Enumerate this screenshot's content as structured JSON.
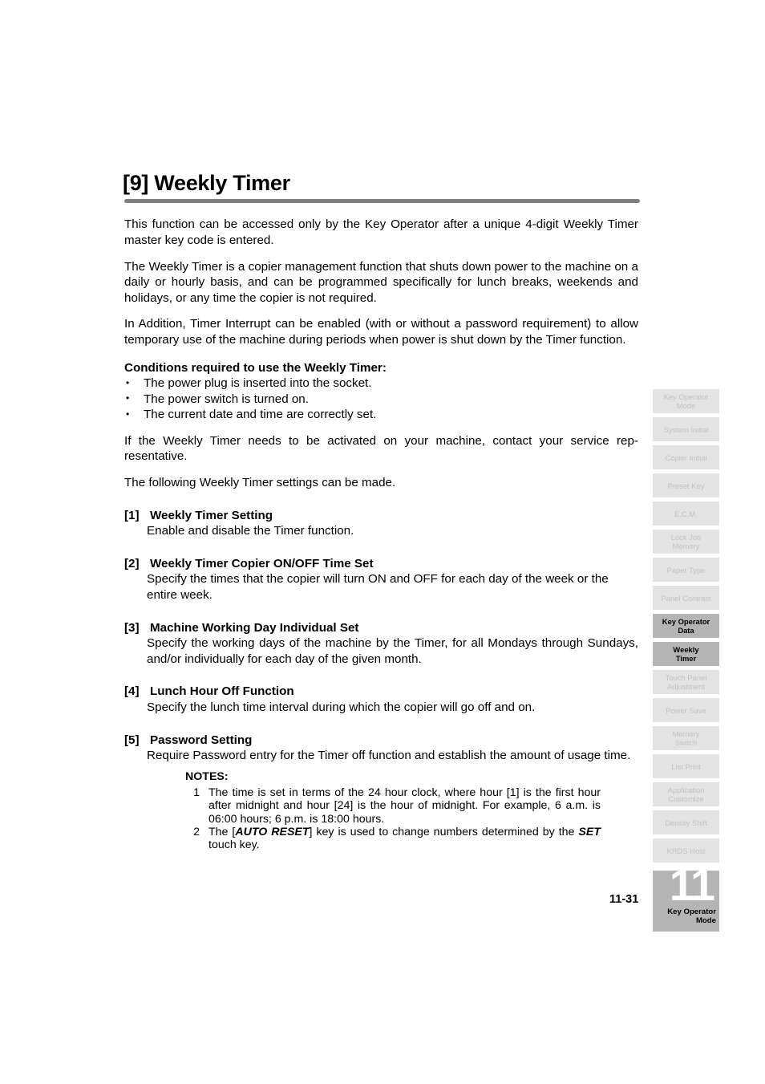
{
  "document": {
    "title": "[9] Weekly Timer",
    "page_number": "11-31"
  },
  "intro_paragraphs": [
    "This function can be accessed only by the Key Operator after a unique 4-digit Weekly Timer master key code is entered.",
    "The Weekly Timer is a copier management function that shuts down power to the machine on a daily or hourly basis, and can be programmed specifically for lunch breaks, weekends and holidays, or any time the copier is not required.",
    "In Addition, Timer Interrupt can be enabled (with or without a password requirement) to allow temporary use of the machine during periods when power is shut down by the Timer function."
  ],
  "conditions": {
    "heading": "Conditions required to use the Weekly Timer:",
    "items": [
      "The power plug is inserted into the socket.",
      "The power switch is turned on.",
      "The current date and time are correctly set."
    ]
  },
  "after_conditions": [
    "If the Weekly Timer needs to be activated on your machine, contact your service rep-resentative.",
    "The following Weekly Timer settings can be made."
  ],
  "settings": [
    {
      "tag": "[1]",
      "heading": "Weekly Timer Setting",
      "body": "Enable and disable the Timer function."
    },
    {
      "tag": "[2]",
      "heading": "Weekly Timer Copier ON/OFF Time Set",
      "body": "Specify the times that the copier will turn ON and OFF for each day of the week or the entire week."
    },
    {
      "tag": "[3]",
      "heading": "Machine Working Day Individual Set",
      "body": "Specify the working days of the machine by the Timer, for all Mondays through Sundays, and/or individually for each day of the given month."
    },
    {
      "tag": "[4]",
      "heading": "Lunch Hour Off Function",
      "body": "Specify the lunch time interval during which the copier will go off and on."
    },
    {
      "tag": "[5]",
      "heading": "Password Setting",
      "body": "Require Password entry for the Timer off function and establish the amount of usage time."
    }
  ],
  "notes": {
    "title": "NOTES:",
    "items": [
      {
        "number": "1",
        "text": "The time is set in terms of the 24 hour clock, where hour [1] is the first hour after midnight and hour [24] is the hour of midnight. For example, 6 a.m. is 06:00 hours; 6 p.m. is 18:00 hours."
      },
      {
        "number": "2",
        "text_before": "The [",
        "emphasis_1": "AUTO RESET",
        "text_middle": "] key is used to change numbers determined by the ",
        "emphasis_2": "SET",
        "text_after": " touch key."
      }
    ]
  },
  "tab_rail": {
    "items": [
      {
        "label": "Key Operator\nMode",
        "active": false
      },
      {
        "label": "System Initial",
        "active": false
      },
      {
        "label": "Copier Initial",
        "active": false
      },
      {
        "label": "Preset Key",
        "active": false
      },
      {
        "label": "E.C.M.",
        "active": false
      },
      {
        "label": "Lock Job\nMemory",
        "active": false
      },
      {
        "label": "Paper Type",
        "active": false
      },
      {
        "label": "Panel Contrast",
        "active": false
      },
      {
        "label": "Key Operator\nData",
        "active": true
      },
      {
        "label": "Weekly\nTimer",
        "active": true
      },
      {
        "label": "Touch Panel\nAdjustment",
        "active": false
      },
      {
        "label": "Power Save",
        "active": false
      },
      {
        "label": "Memory\nSwitch",
        "active": false
      },
      {
        "label": "List Print",
        "active": false
      },
      {
        "label": "Application\nCustomize",
        "active": false
      },
      {
        "label": "Density Shift",
        "active": false
      },
      {
        "label": "KRDS Host",
        "active": false
      }
    ],
    "colors": {
      "inactive_bg": "#e3e3e3",
      "inactive_text": "#c3c3c3",
      "active_bg": "#b4b4b4",
      "active_text": "#000000"
    }
  },
  "chapter_marker": {
    "number": "11",
    "label": "Key Operator\nMode",
    "bg": "#b4b4b4"
  }
}
